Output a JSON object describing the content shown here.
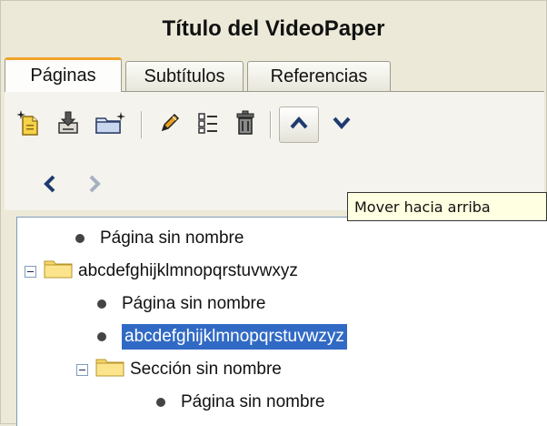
{
  "panel": {
    "title": "Título del VideoPaper"
  },
  "tabs": [
    {
      "label": "Páginas",
      "active": true
    },
    {
      "label": "Subtítulos",
      "active": false
    },
    {
      "label": "Referencias",
      "active": false
    }
  ],
  "toolbar": {
    "icons": [
      "new-page-icon",
      "import-icon",
      "new-folder-icon",
      "edit-icon",
      "properties-icon",
      "delete-icon",
      "move-up-icon",
      "move-down-icon"
    ],
    "nav_icons": [
      "move-left-icon",
      "move-right-icon"
    ],
    "tooltip": "Mover hacia arriba"
  },
  "tree": {
    "n0": "Página sin nombre",
    "n1": "abcdefghijklmnopqrstuvwxyz",
    "n2": "Página sin nombre",
    "n3": "abcdefghijklmnopqrstuvwzyz",
    "n4": "Sección sin nombre",
    "n5": "Página sin nombre"
  },
  "colors": {
    "selection": "#316ac5",
    "tab_accent": "#f0a42a",
    "folder": "#f5d66b"
  }
}
